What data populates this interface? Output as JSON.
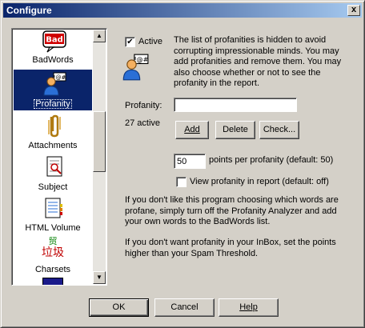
{
  "window": {
    "title": "Configure",
    "close_glyph": "x"
  },
  "categories": [
    {
      "label": "BadWords",
      "icon": "badwords-icon"
    },
    {
      "label": "Profanity",
      "icon": "profanity-icon",
      "selected": true
    },
    {
      "label": "Attachments",
      "icon": "paperclip-icon"
    },
    {
      "label": "Subject",
      "icon": "subject-icon"
    },
    {
      "label": "HTML Volume",
      "icon": "html-volume-icon"
    },
    {
      "label": "Charsets",
      "icon": "charsets-icon",
      "glyphs": "垃圾"
    }
  ],
  "badwords_icon_text": "Bad",
  "profanity_panel": {
    "active_label": "Active",
    "active_checked": true,
    "description": "The list of profanities is hidden to avoid corrupting impressionable minds.  You may add profanities and remove them.  You may also choose whether or not to see the profanity in the report.",
    "profanity_label": "Profanity:",
    "profanity_value": "",
    "count_text": "27 active",
    "add_label": "Add",
    "delete_label": "Delete",
    "check_label": "Check...",
    "points_value": "50",
    "points_label": "points per profanity (default: 50)",
    "view_label": "View profanity in report (default: off)",
    "view_checked": false,
    "help_text_1": "If you don't like this program choosing which words are profane, simply turn off the Profanity Analyzer and add your own words to the BadWords list.",
    "help_text_2": "If you don't want profanity in your InBox, set the points higher than your Spam Threshold."
  },
  "footer": {
    "ok_label": "OK",
    "cancel_label": "Cancel",
    "help_label": "Help"
  },
  "colors": {
    "titlebar_start": "#0a246a",
    "titlebar_end": "#a6caf0",
    "selection": "#0a246a",
    "face": "#d4d0c8"
  }
}
